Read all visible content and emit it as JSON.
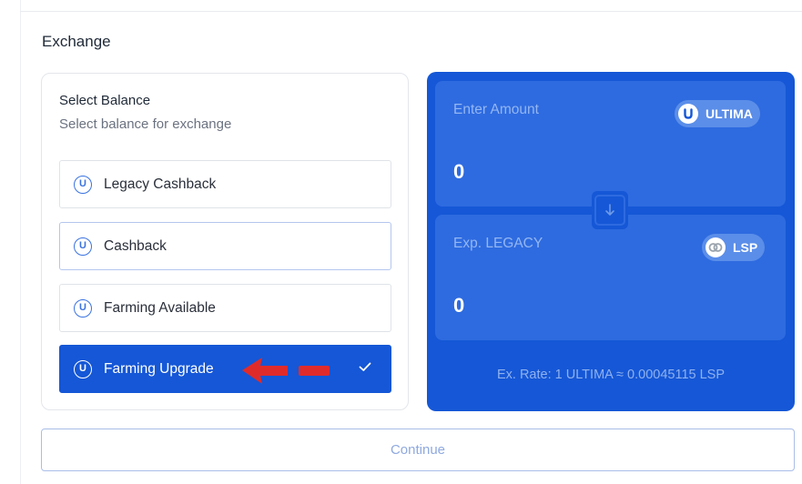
{
  "header": {
    "title": "Exchange"
  },
  "select_balance": {
    "title": "Select Balance",
    "subtitle": "Select balance for exchange",
    "options": [
      {
        "label": "Legacy Cashback",
        "icon": "ultima-icon",
        "state": "default"
      },
      {
        "label": "Cashback",
        "icon": "ultima-icon",
        "state": "hovered"
      },
      {
        "label": "Farming Available",
        "icon": "ultima-icon",
        "state": "default"
      },
      {
        "label": "Farming Upgrade",
        "icon": "ultima-icon",
        "state": "selected"
      }
    ],
    "icon_glyph": "U"
  },
  "exchange": {
    "from": {
      "label": "Enter Amount",
      "value": "0",
      "currency": "ULTIMA",
      "currency_icon": "ultima-icon"
    },
    "to": {
      "label": "Exp. LEGACY",
      "value": "0",
      "currency": "LSP",
      "currency_icon": "lsp-icon"
    },
    "swap_icon": "arrow-down-icon",
    "rate": "Ex. Rate: 1 ULTIMA ≈ 0.00045115 LSP"
  },
  "continue_label": "Continue",
  "colors": {
    "primary": "#1557d6",
    "panel_box": "#2e6be0",
    "annotation_arrow": "#e02b2b"
  }
}
